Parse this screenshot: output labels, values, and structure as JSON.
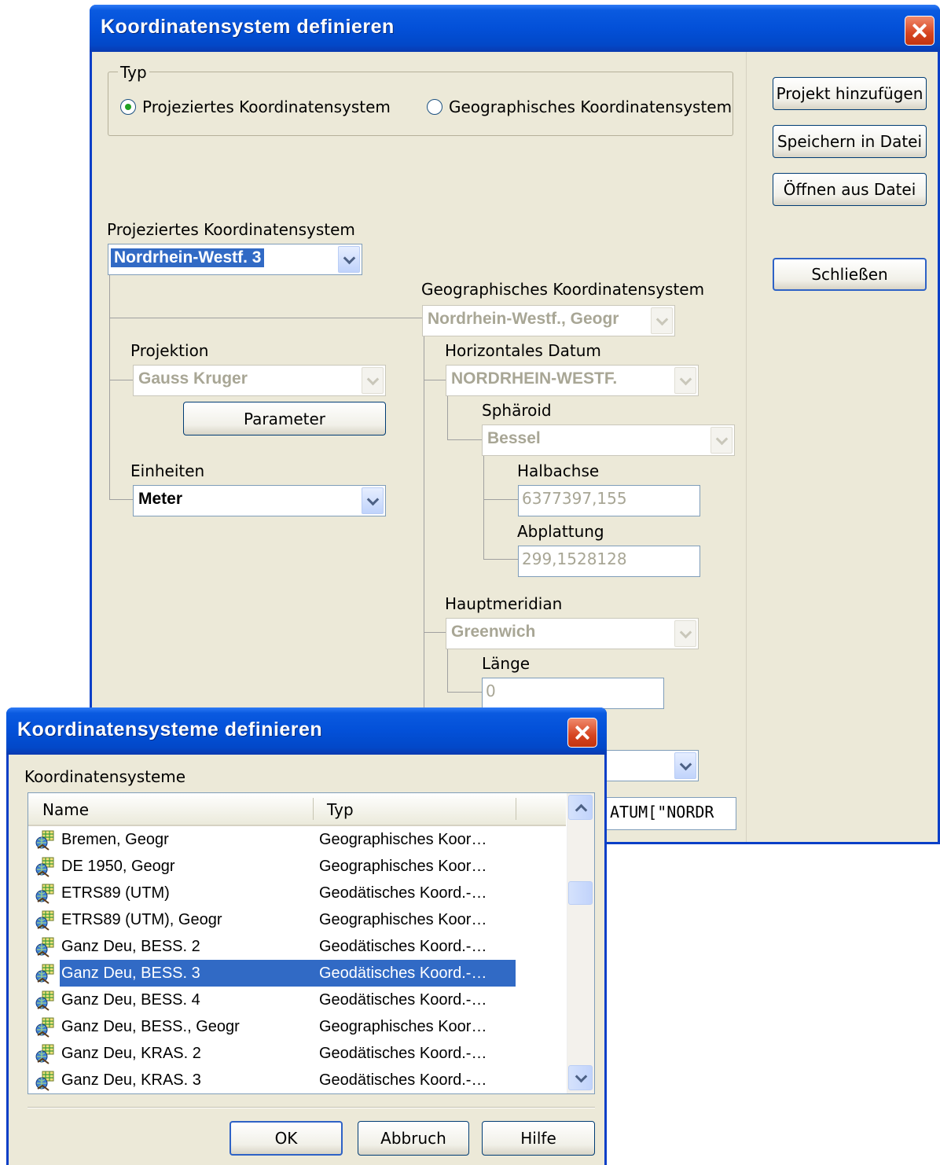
{
  "main_window": {
    "title": "Koordinatensystem definieren",
    "type_group": {
      "legend": "Typ",
      "options": [
        {
          "label": "Projeziertes Koordinatensystem",
          "selected": true
        },
        {
          "label": "Geographisches Koordinatensystem",
          "selected": false
        }
      ]
    },
    "side_buttons": {
      "add_project": "Projekt hinzufügen",
      "save_file": "Speichern in Datei",
      "open_file": "Öffnen aus Datei",
      "close": "Schließen"
    },
    "projected": {
      "label": "Projeziertes Koordinatensystem",
      "value": "Nordrhein-Westf. 3"
    },
    "projection": {
      "label": "Projektion",
      "value": "Gauss Kruger",
      "parameter_button": "Parameter"
    },
    "units": {
      "label": "Einheiten",
      "value": "Meter"
    },
    "geographic": {
      "label": "Geographisches Koordinatensystem",
      "value": "Nordrhein-Westf., Geogr"
    },
    "datum": {
      "label": "Horizontales Datum",
      "value": "NORDRHEIN-WESTF."
    },
    "spheroid": {
      "label": "Sphäroid",
      "value": "Bessel",
      "semi_axis_label": "Halbachse",
      "semi_axis_value": "6377397,155",
      "flattening_label": "Abplattung",
      "flattening_value": "299,1528128"
    },
    "prime_meridian": {
      "label": "Hauptmeridian",
      "value": "Greenwich",
      "longitude_label": "Länge",
      "longitude_value": "0"
    },
    "wkt_fragment": "ATUM[\"NORDR"
  },
  "dialog": {
    "title": "Koordinatensysteme definieren",
    "list_label": "Koordinatensysteme",
    "columns": [
      "Name",
      "Typ"
    ],
    "rows": [
      {
        "name": "Bremen, Geogr",
        "type": "Geographisches Koor…",
        "selected": false
      },
      {
        "name": "DE 1950, Geogr",
        "type": "Geographisches Koor…",
        "selected": false
      },
      {
        "name": "ETRS89 (UTM)",
        "type": "Geodätisches Koord.-…",
        "selected": false
      },
      {
        "name": "ETRS89 (UTM), Geogr",
        "type": "Geographisches Koor…",
        "selected": false
      },
      {
        "name": "Ganz Deu, BESS. 2",
        "type": "Geodätisches Koord.-…",
        "selected": false
      },
      {
        "name": "Ganz Deu, BESS. 3",
        "type": "Geodätisches Koord.-…",
        "selected": true
      },
      {
        "name": "Ganz Deu, BESS. 4",
        "type": "Geodätisches Koord.-…",
        "selected": false
      },
      {
        "name": "Ganz Deu, BESS., Geogr",
        "type": "Geographisches Koor…",
        "selected": false
      },
      {
        "name": "Ganz Deu, KRAS. 2",
        "type": "Geodätisches Koord.-…",
        "selected": false
      },
      {
        "name": "Ganz Deu, KRAS. 3",
        "type": "Geodätisches Koord.-…",
        "selected": false
      }
    ],
    "buttons": {
      "ok": "OK",
      "cancel": "Abbruch",
      "help": "Hilfe"
    }
  }
}
